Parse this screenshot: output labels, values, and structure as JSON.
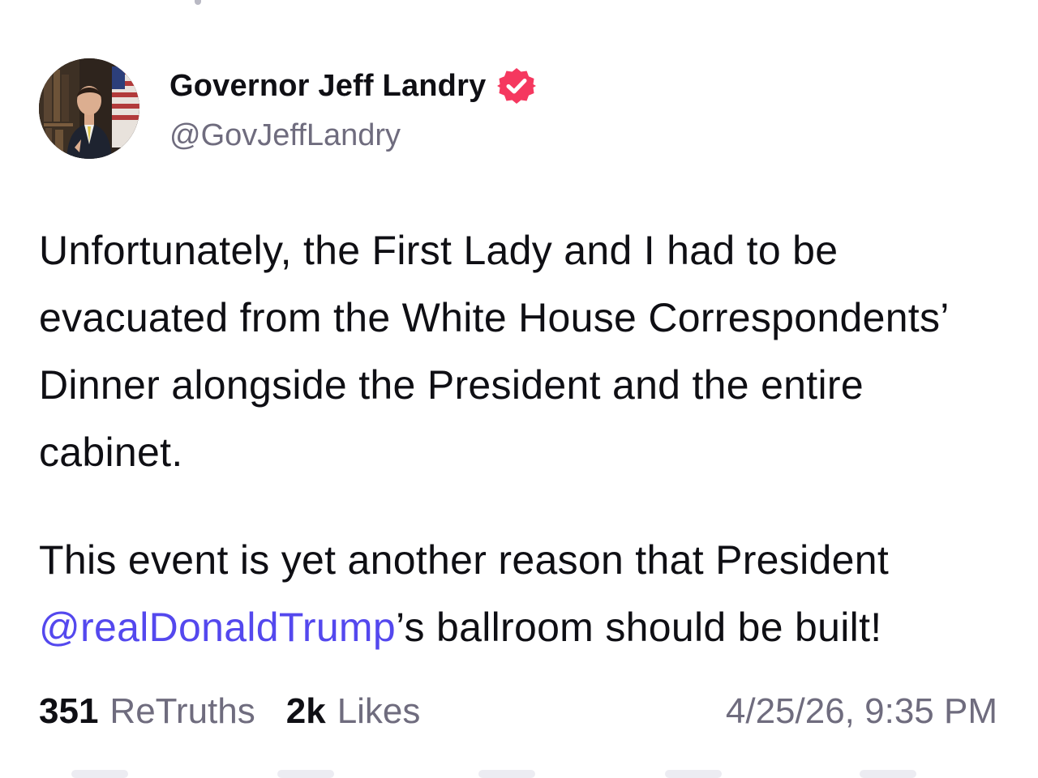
{
  "colors": {
    "text": "#0f0f14",
    "muted": "#6f6c7e",
    "mention": "#5448ee",
    "verified_badge": "#f5385f"
  },
  "post": {
    "author": {
      "display_name": "Governor Jeff Landry",
      "handle": "@GovJeffLandry",
      "avatar_icon": "avatar-photo",
      "verified_icon": "verified-badge-icon"
    },
    "paragraph1": "Unfortunately, the First Lady and I had to be evacuated from the White House Correspondents’ Dinner alongside the President and the entire cabinet.",
    "paragraph2_prefix": "This event is yet another reason that President ",
    "paragraph2_mention": "@realDonaldTrump",
    "paragraph2_suffix": "’s ballroom should be built!",
    "stats": {
      "retruths_count": "351",
      "retruths_label": "ReTruths",
      "likes_count": "2k",
      "likes_label": "Likes"
    },
    "timestamp": "4/25/26, 9:35 PM"
  }
}
